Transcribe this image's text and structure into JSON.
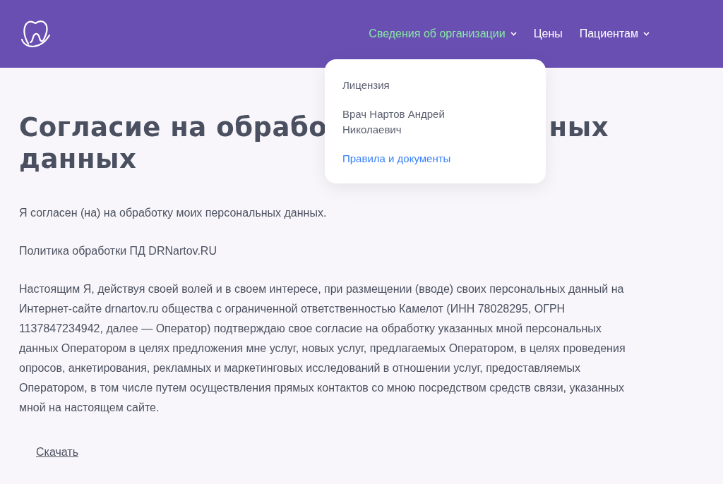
{
  "header": {
    "nav": [
      {
        "label": "Сведения об организации",
        "selected": true,
        "has_menu": true
      },
      {
        "label": "Цены",
        "selected": false,
        "has_menu": false
      },
      {
        "label": "Пациентам",
        "selected": false,
        "has_menu": true
      }
    ]
  },
  "dropdown": {
    "items": [
      {
        "label": "Лицензия",
        "selected": false
      },
      {
        "label": "Врач Нартов Андрей Николаевич",
        "selected": false
      },
      {
        "label": "Правила и документы",
        "selected": true
      }
    ]
  },
  "title": {
    "line_1_start": "Согласие на обрабо",
    "line_1_end": "ных",
    "line_2": "данных"
  },
  "paragraphs": [
    "Я согласен (на) на обработку моих персональных данных.",
    "Политика обработки ПД DRNartov.RU",
    "Настоящим Я, действуя своей волей и в своем интересе, при размещении (вводе) своих персональных данный на Интернет-сайте drnartov.ru общества с ограниченной ответственностью Камелот (ИНН 78028295, ОГРН 1137847234942, далее — Оператор) подтверждаю свое согласие на обработку указанных мной персональных данных Оператором в целях предложения мне услуг, новых услуг, предлагаемых Оператором, в целях проведения опросов, анкетирования, рекламных и маркетинговых исследований в отношении услуг, предоставляемых Оператором, в том числе путем осуществления прямых контактов со мною посредством средств связи, указанных мной на настоящем сайте."
  ],
  "download_link": "Скачать"
}
